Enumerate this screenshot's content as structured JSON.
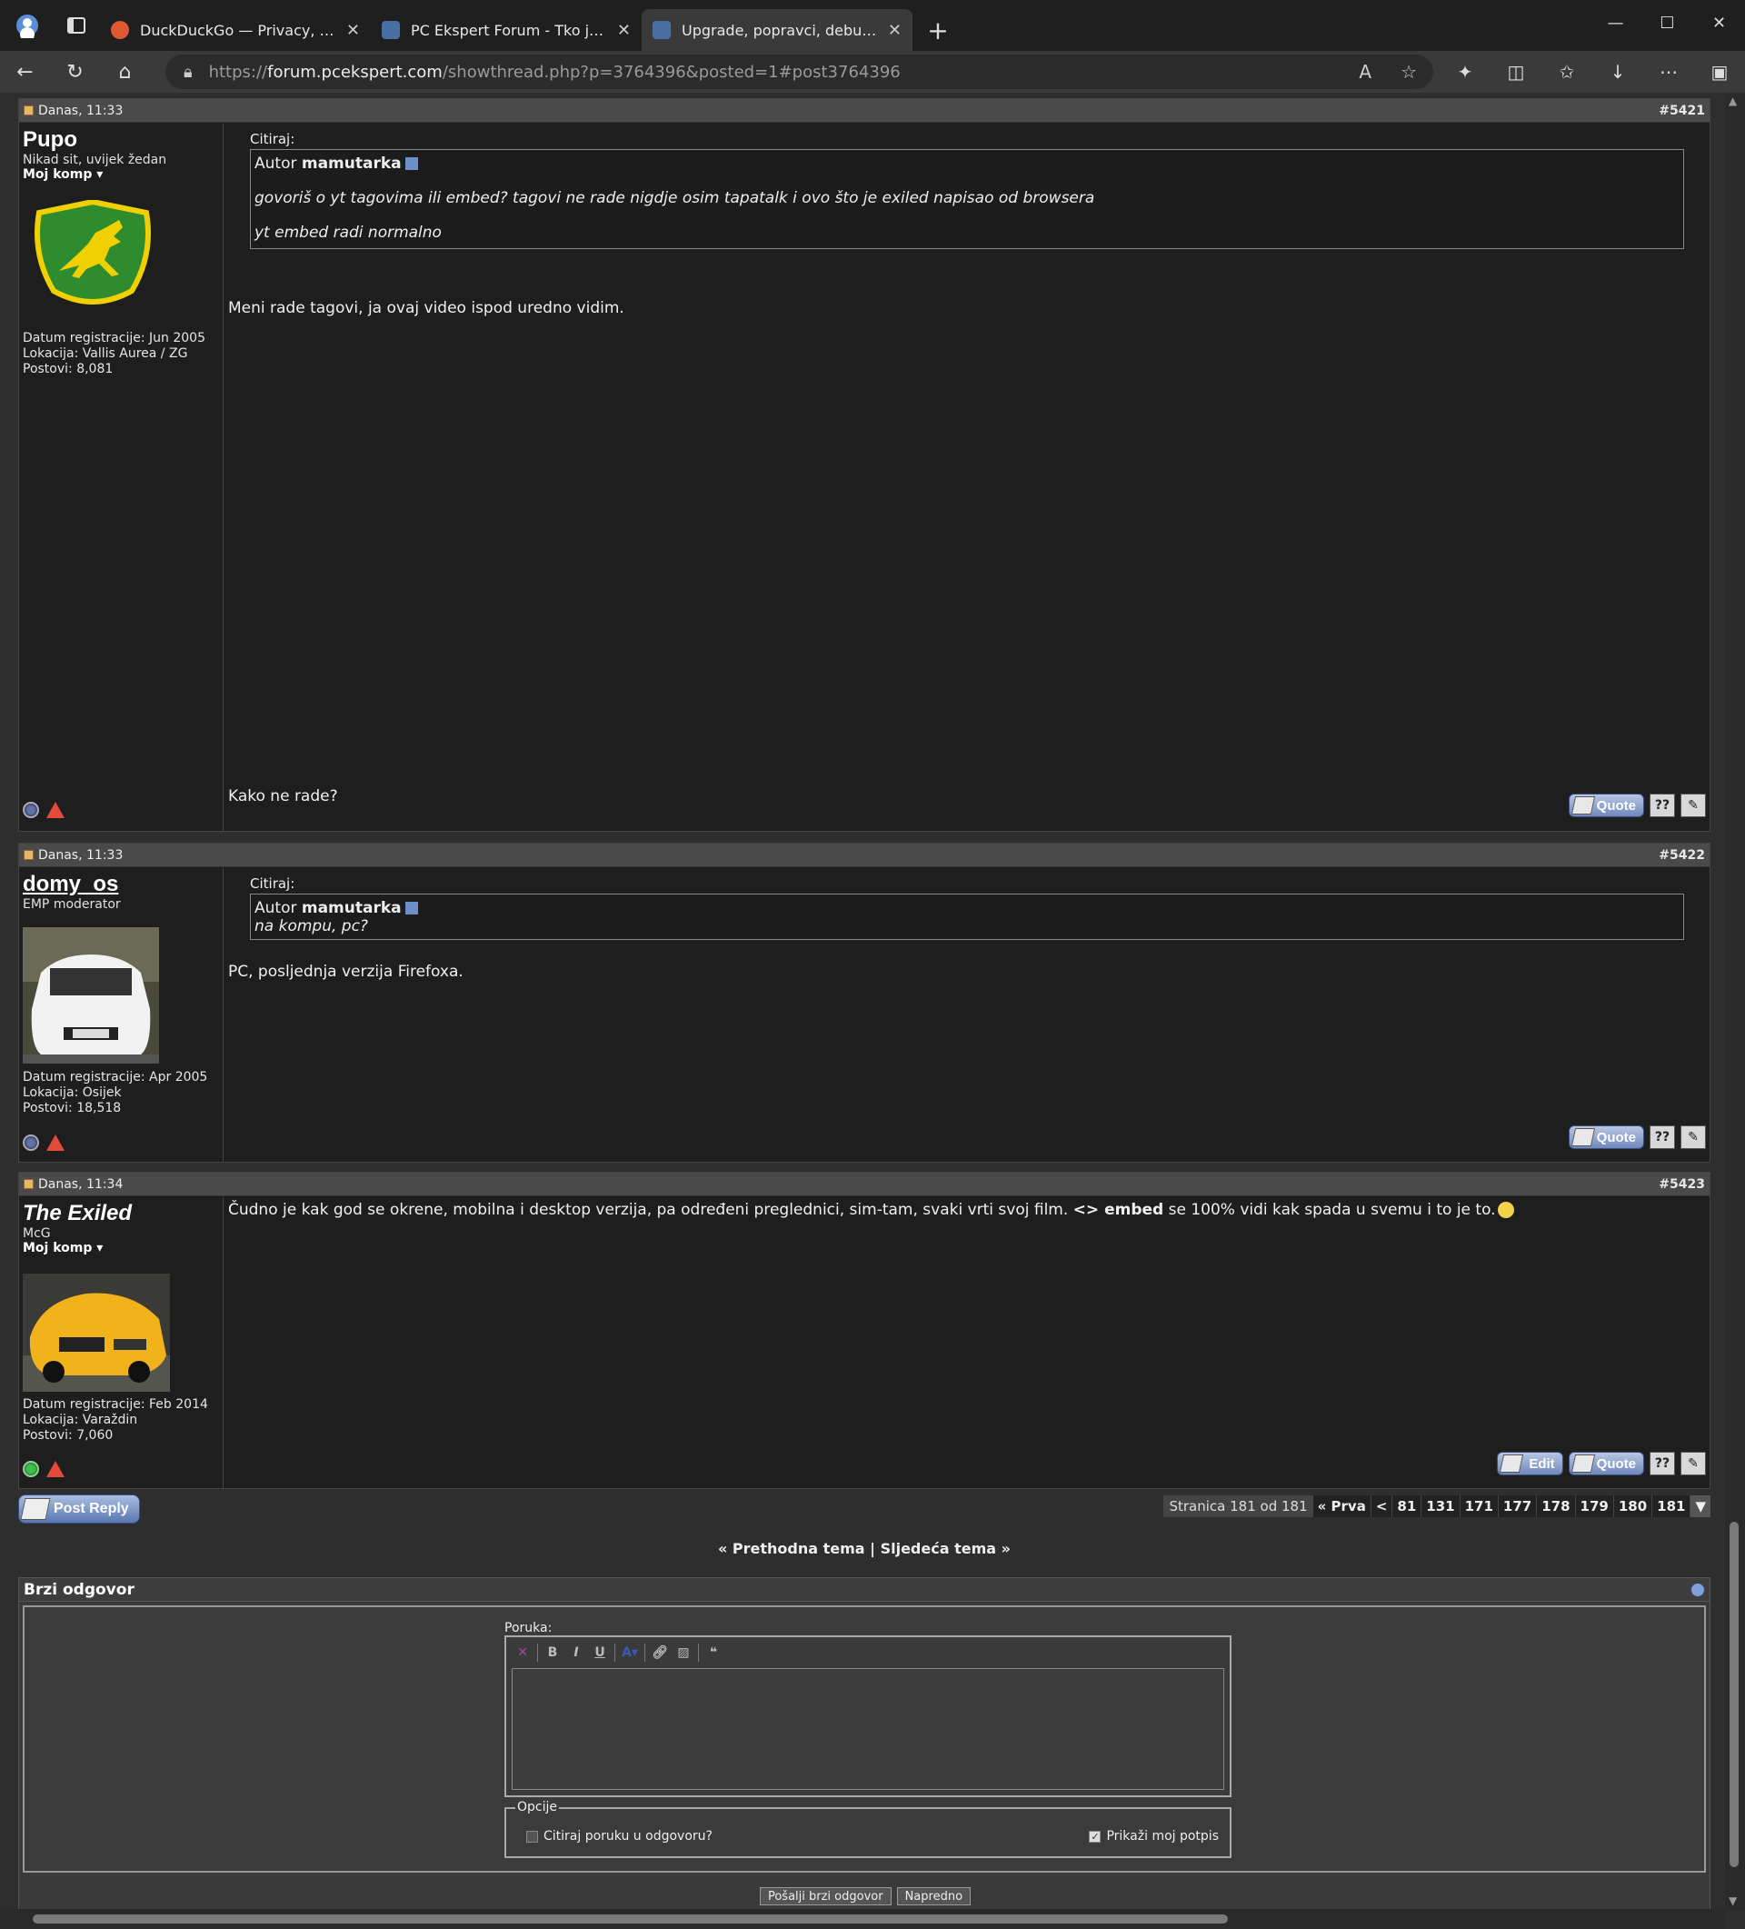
{
  "browser": {
    "tabs": [
      {
        "title": "DuckDuckGo — Privacy, simplified.",
        "fav_color": "#de5833"
      },
      {
        "title": "PC Ekspert Forum - Tko je online",
        "fav_color": "#4a6fa5"
      },
      {
        "title": "Upgrade, popravci, debugiranje...",
        "fav_color": "#4a6fa5"
      }
    ],
    "url_prefix": "https://",
    "url_host": "forum.pcekspert.com",
    "url_path": "/showthread.php?p=3764396&posted=1#post3764396"
  },
  "posts": [
    {
      "date": "Danas, 11:33",
      "number": "#5421",
      "username": "Pupo",
      "user_title": "Nikad sit, uvijek žedan",
      "my_komp": "Moj komp",
      "reg": "Datum registracije: Jun 2005",
      "loc": "Lokacija: Vallis Aurea / ZG",
      "posts": "Postovi: 8,081",
      "quote_label": "Citiraj:",
      "quote_author_prefix": "Autor",
      "quote_author": "mamutarka",
      "quote_lines": [
        "govoriš o yt tagovima ili embed? tagovi ne rade nigdje osim tapatalk i ovo što je exiled napisao od browsera",
        "yt embed radi normalno"
      ],
      "text1": "Meni rade tagovi, ja ovaj video ispod uredno vidim.",
      "text2": "Kako ne rade?",
      "quote_btn": "Quote"
    },
    {
      "date": "Danas, 11:33",
      "number": "#5422",
      "username": "domy_os",
      "user_title": "EMP moderator",
      "reg": "Datum registracije: Apr 2005",
      "loc": "Lokacija: Osijek",
      "posts": "Postovi: 18,518",
      "quote_label": "Citiraj:",
      "quote_author_prefix": "Autor",
      "quote_author": "mamutarka",
      "quote_lines": [
        "na kompu, pc?"
      ],
      "text1": "PC, posljednja verzija Firefoxa.",
      "quote_btn": "Quote"
    },
    {
      "date": "Danas, 11:34",
      "number": "#5423",
      "username": "The Exiled",
      "user_title": "McG",
      "my_komp": "Moj komp",
      "reg": "Datum registracije: Feb 2014",
      "loc": "Lokacija: Varaždin",
      "posts": "Postovi: 7,060",
      "text_a": "Čudno je kak god se okrene, mobilna i desktop verzija, pa određeni preglednici, sim-tam, svaki vrti svoj film. ",
      "text_b": "<> embed",
      "text_c": " se 100% vidi kak spada u svemu i to je to.",
      "edit_btn": "Edit",
      "quote_btn": "Quote"
    }
  ],
  "post_reply": "Post Reply",
  "pager": {
    "label": "Stranica 181 od 181",
    "first": "« Prva",
    "prev": "<",
    "pages": [
      "81",
      "131",
      "171",
      "177",
      "178",
      "179",
      "180",
      "181"
    ]
  },
  "thread_nav": "« Prethodna tema | Sljedeća tema »",
  "quick_reply": {
    "title": "Brzi odgovor",
    "message_label": "Poruka:",
    "options_label": "Opcije",
    "quote_option": "Citiraj poruku u odgovoru?",
    "signature_option": "Prikaži moj potpis",
    "submit": "Pošalji brzi odgovor",
    "advanced": "Napredno"
  }
}
